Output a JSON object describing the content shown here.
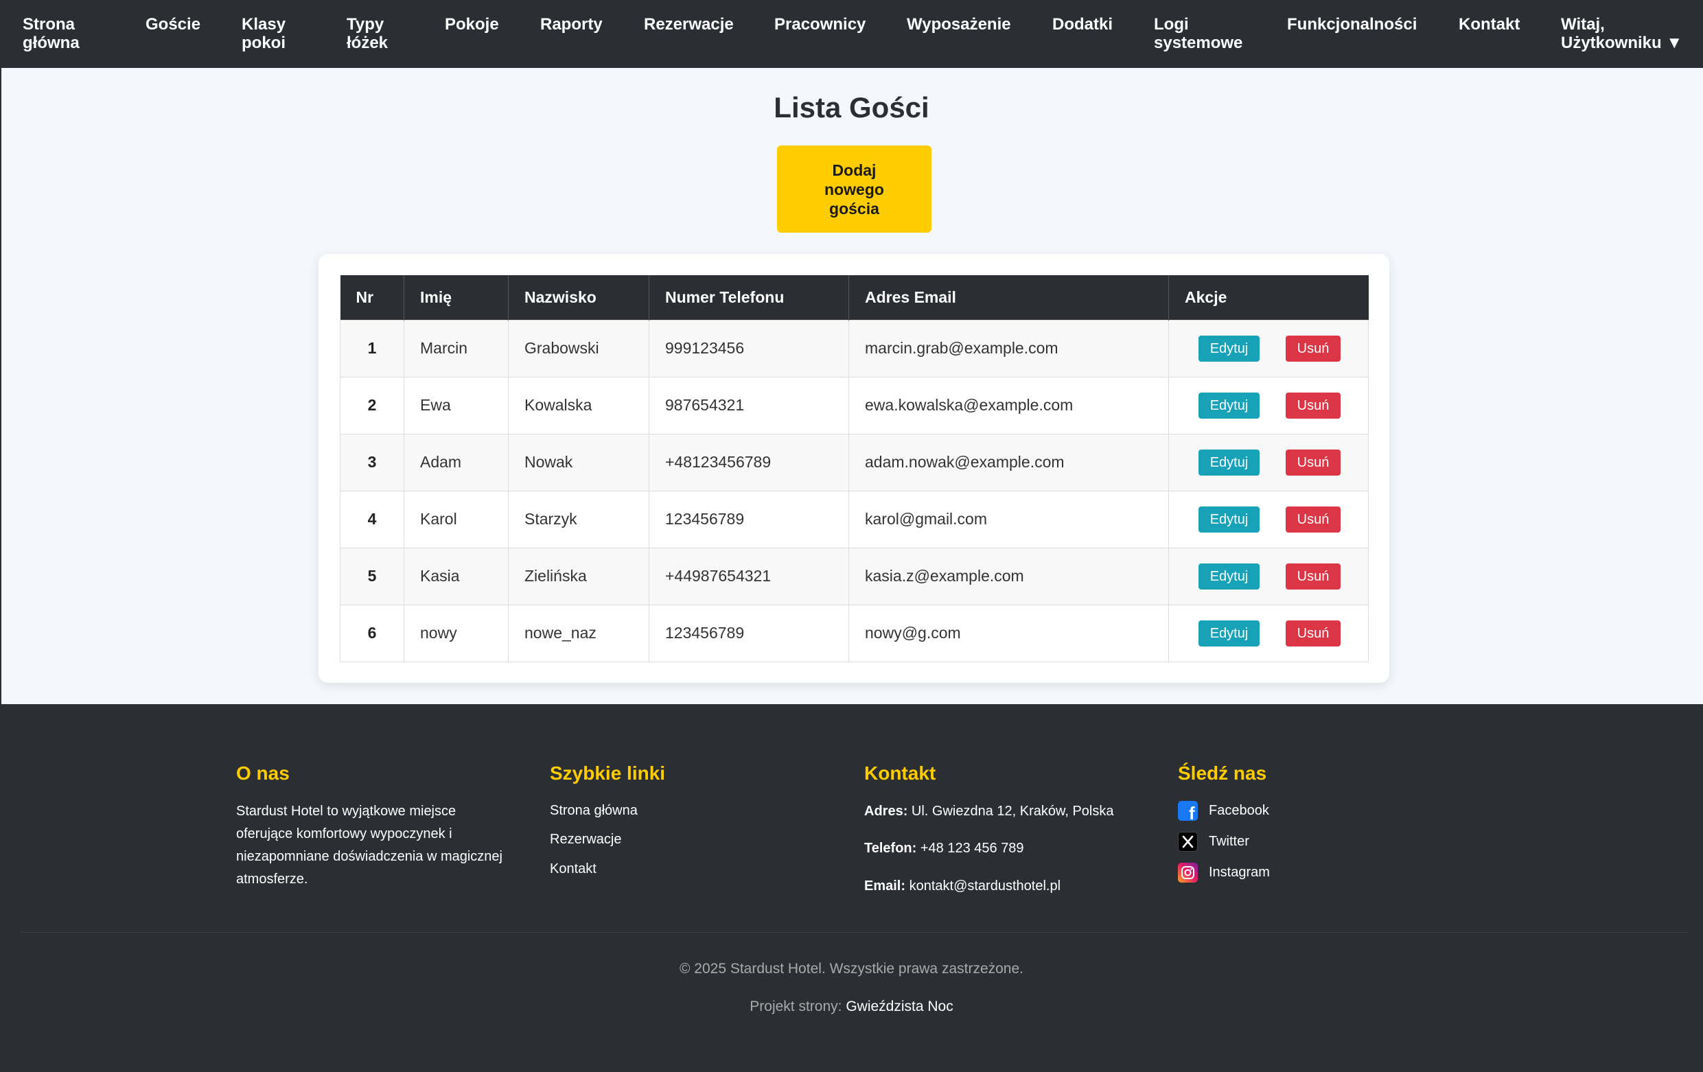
{
  "nav": {
    "home": [
      "Strona",
      "główna"
    ],
    "guests": [
      "Goście",
      ""
    ],
    "room_classes": [
      "Klasy",
      "pokoi"
    ],
    "bed_types": [
      "Typy",
      "łóżek"
    ],
    "rooms": [
      "Pokoje",
      ""
    ],
    "reports": [
      "Raporty",
      ""
    ],
    "reservations": [
      "Rezerwacje",
      ""
    ],
    "employees": [
      "Pracownicy",
      ""
    ],
    "equipment": [
      "Wyposażenie",
      ""
    ],
    "extras": [
      "Dodatki",
      ""
    ],
    "logs": [
      "Logi",
      "systemowe"
    ],
    "features": [
      "Funkcjonalności",
      ""
    ],
    "contact": [
      "Kontakt",
      ""
    ],
    "user_menu": [
      "Witaj,",
      "Użytkowniku ▼"
    ]
  },
  "page": {
    "title": "Lista Gości",
    "add_button": [
      "Dodaj",
      "nowego",
      "gościa"
    ]
  },
  "table": {
    "headers": [
      "Nr",
      "Imię",
      "Nazwisko",
      "Numer Telefonu",
      "Adres Email",
      "Akcje"
    ],
    "rows": [
      {
        "nr": "1",
        "first": "Marcin",
        "last": "Grabowski",
        "phone": "999123456",
        "email": "marcin.grab@example.com"
      },
      {
        "nr": "2",
        "first": "Ewa",
        "last": "Kowalska",
        "phone": "987654321",
        "email": "ewa.kowalska@example.com"
      },
      {
        "nr": "3",
        "first": "Adam",
        "last": "Nowak",
        "phone": "+48123456789",
        "email": "adam.nowak@example.com"
      },
      {
        "nr": "4",
        "first": "Karol",
        "last": "Starzyk",
        "phone": "123456789",
        "email": "karol@gmail.com"
      },
      {
        "nr": "5",
        "first": "Kasia",
        "last": "Zielińska",
        "phone": "+44987654321",
        "email": "kasia.z@example.com"
      },
      {
        "nr": "6",
        "first": "nowy",
        "last": "nowe_naz",
        "phone": "123456789",
        "email": "nowy@g.com"
      }
    ],
    "edit_label": "Edytuj",
    "delete_label": "Usuń"
  },
  "footer": {
    "about": {
      "title": "O nas",
      "lines": [
        "Stardust Hotel to wyjątkowe miejsce",
        "oferujące komfortowy wypoczynek i",
        "niezapomniane doświadczenia w magicznej",
        "atmosferze."
      ]
    },
    "quick_links": {
      "title": "Szybkie linki",
      "links": [
        "Strona główna",
        "Rezerwacje",
        "Kontakt"
      ]
    },
    "contact": {
      "title": "Kontakt",
      "address_label": "Adres:",
      "address": " Ul. Gwiezdna 12, Kraków, Polska",
      "phone_label": "Telefon:",
      "phone": " +48 123 456 789",
      "email_label": "Email:",
      "email": " kontakt@stardusthotel.pl"
    },
    "social": {
      "title": "Śledź nas",
      "items": [
        {
          "label": "Facebook",
          "icon": "facebook-icon"
        },
        {
          "label": "Twitter",
          "icon": "x-twitter-icon"
        },
        {
          "label": "Instagram",
          "icon": "instagram-icon"
        }
      ]
    },
    "copyright": "© 2025 Stardust Hotel. Wszystkie prawa zastrzeżone.",
    "credits_prefix": "Projekt strony: ",
    "credits_link": "Gwieździsta Noc"
  },
  "colors": {
    "navbar_bg": "#2b2e33",
    "accent_yellow": "#ffcc00",
    "edit_button": "#17a2b8",
    "delete_button": "#dc3545",
    "page_bg": "#f4f7fc"
  }
}
